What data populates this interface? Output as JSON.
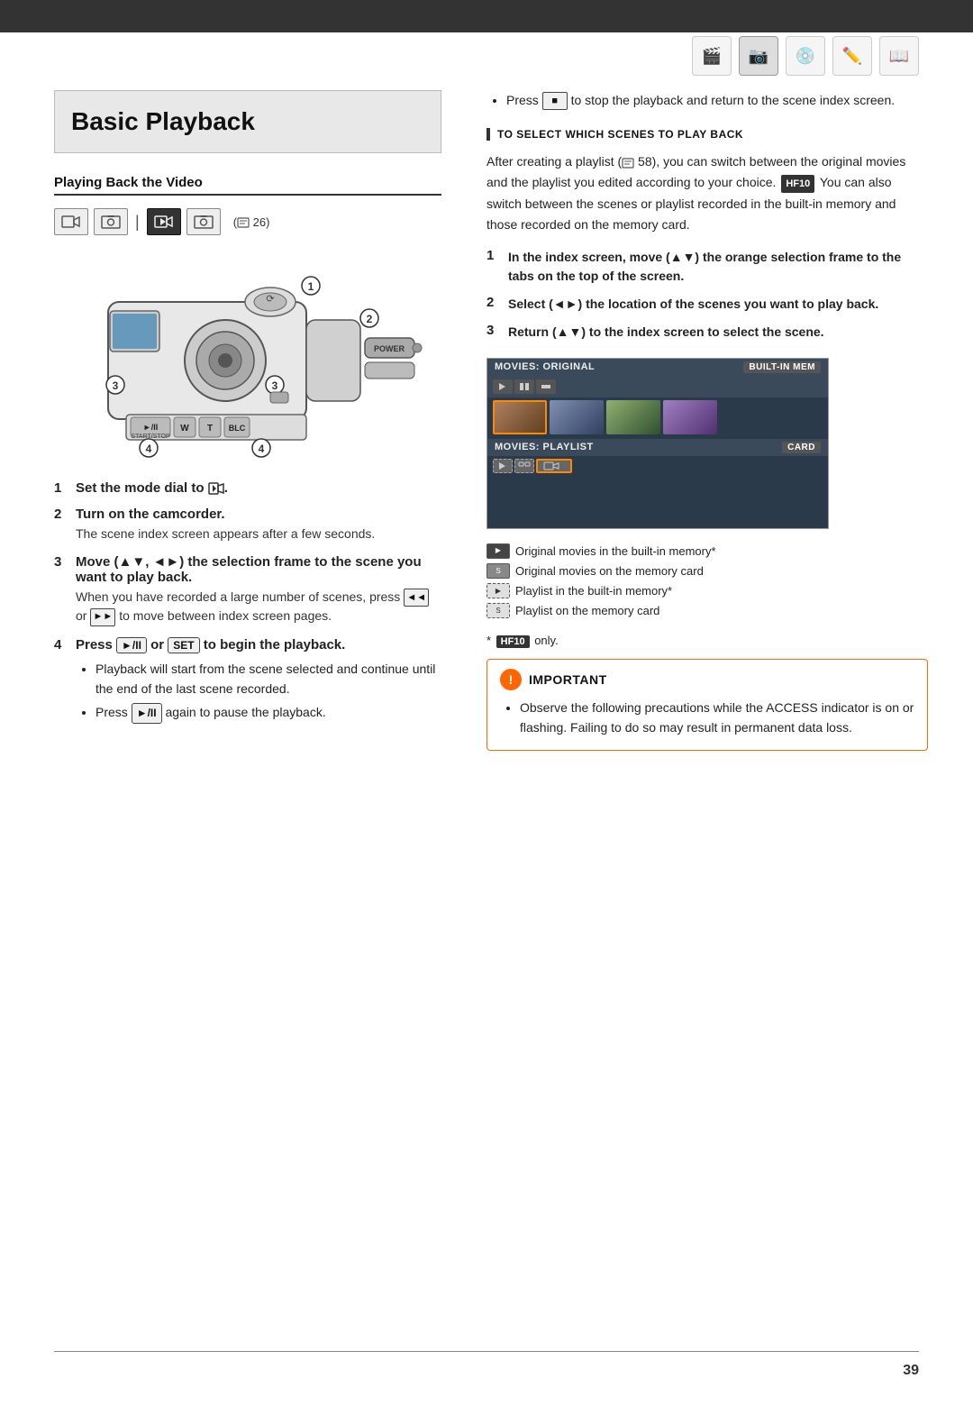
{
  "topbar": {
    "bg": "#333"
  },
  "icons": [
    {
      "name": "film-icon",
      "symbol": "🎬"
    },
    {
      "name": "camera-icon",
      "symbol": "📷"
    },
    {
      "name": "disc-icon",
      "symbol": "💿"
    },
    {
      "name": "edit-icon",
      "symbol": "✏️"
    },
    {
      "name": "book-icon",
      "symbol": "📖"
    }
  ],
  "title": "Basic Playback",
  "leftCol": {
    "sectionHeading": "Playing Back the Video",
    "modeIcons": [
      "🎬",
      "📷",
      "|",
      "▶",
      "📷"
    ],
    "pageRef": "(m 26)",
    "steps": [
      {
        "num": "1",
        "bold": "Set the mode dial to ʻ꜀.",
        "desc": ""
      },
      {
        "num": "2",
        "bold": "Turn on the camcorder.",
        "desc": "The scene index screen appears after a few seconds."
      },
      {
        "num": "3",
        "bold": "Move (▲▼, ◄►) the selection frame to the scene you want to play back.",
        "desc": "When you have recorded a large number of scenes, press ◄◄ or ►► to move between index screen pages."
      },
      {
        "num": "4",
        "bold": "Press ►/II or SET to begin the playback.",
        "desc": ""
      }
    ],
    "subBullets4": [
      "Playback will start from the scene selected and continue until the end of the last scene recorded.",
      "Press ►/II again to pause the playback."
    ]
  },
  "rightCol": {
    "topBullets": [
      "Press ■ to stop the playback and return to the scene index screen."
    ],
    "sectionLabel": "To select which scenes to play back",
    "bodyText1": "After creating a playlist (m 58), you can switch between the original movies and the playlist you edited according to your choice.",
    "hf10Badge": "HF10",
    "bodyText2": "You can also switch between the scenes or playlist recorded in the built-in memory and those recorded on the memory card.",
    "rightSteps": [
      {
        "num": "1",
        "text": "In the index screen, move (▲▼) the orange selection frame to the tabs on the top of the screen."
      },
      {
        "num": "2",
        "text": "Select (◄►) the location of the scenes you want to play back."
      },
      {
        "num": "3",
        "text": "Return (▲▼) to the index screen to select the scene."
      }
    ],
    "sceneIndex": {
      "bar1Label": "MOVIES: ORIGINAL",
      "bar1Right": "BUILT-IN MEM",
      "bar2Label": "MOVIES: PLAYLIST",
      "bar2Right": "CARD"
    },
    "legend": [
      {
        "icon": "solid",
        "hf10": false,
        "text": "Original movies in the built-in memory*"
      },
      {
        "icon": "solid-s",
        "hf10": false,
        "text": "Original movies on the memory card"
      },
      {
        "icon": "dashed",
        "hf10": false,
        "text": "Playlist in the built-in memory*"
      },
      {
        "icon": "dashed-s",
        "hf10": false,
        "text": "Playlist on the memory card"
      }
    ],
    "footnote": "* HF10 only.",
    "importantTitle": "Important",
    "importantText": "Observe the following precautions while the ACCESS indicator is on or flashing. Failing to do so may result in permanent data loss."
  },
  "pageNumber": "39",
  "pressLabel": "Press"
}
